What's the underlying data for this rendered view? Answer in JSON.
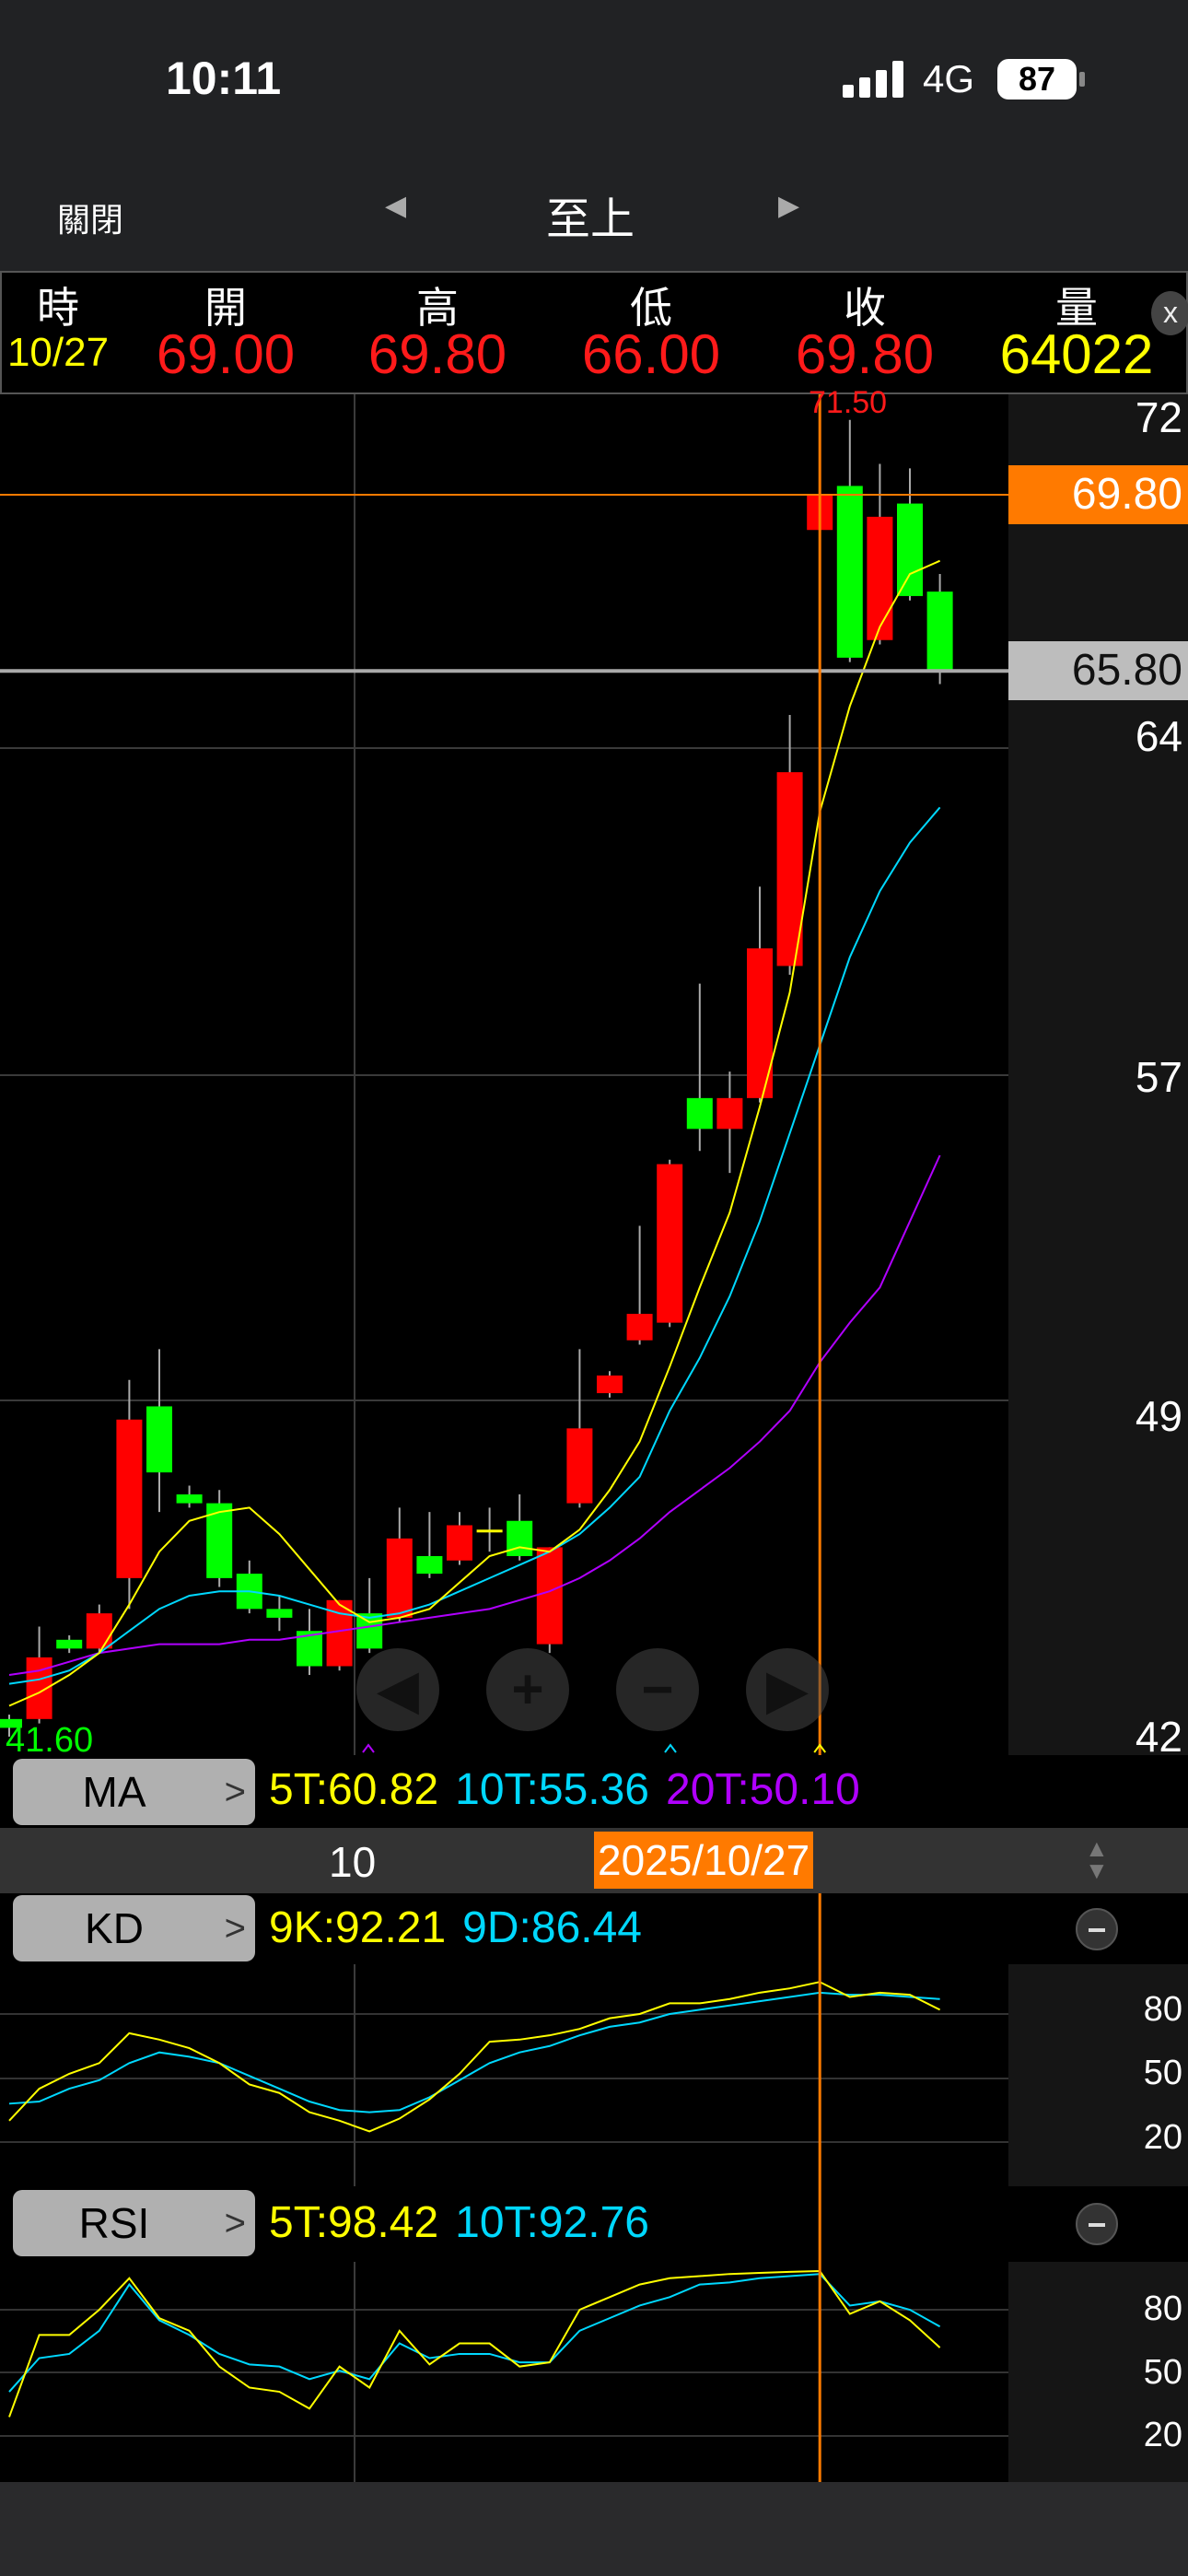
{
  "status": {
    "time": "10:11",
    "network": "4G",
    "battery": "87"
  },
  "nav": {
    "close": "關閉",
    "title": "至上",
    "prev": "◀",
    "next": "▶"
  },
  "header": {
    "labels": [
      "時",
      "開",
      "高",
      "低",
      "收",
      "量"
    ],
    "values": [
      "10/27",
      "69.00",
      "69.80",
      "66.00",
      "69.80",
      "64022"
    ],
    "close_icon": "x"
  },
  "chart_data": {
    "type": "candlestick",
    "y_ticks": [
      "72",
      "64",
      "57",
      "49",
      "42"
    ],
    "price_lines": {
      "last": "69.80",
      "ref": "65.80"
    },
    "max_label": "71.50",
    "min_label": "41.60",
    "candles": [
      [
        42.0,
        42.1,
        41.6,
        41.8
      ],
      [
        42.0,
        44.1,
        41.9,
        43.4
      ],
      [
        43.8,
        43.9,
        43.5,
        43.6
      ],
      [
        43.6,
        44.6,
        43.5,
        44.4
      ],
      [
        45.2,
        49.7,
        44.5,
        48.8
      ],
      [
        49.1,
        50.4,
        46.7,
        47.6
      ],
      [
        47.1,
        47.3,
        46.8,
        46.9
      ],
      [
        46.9,
        47.2,
        45.0,
        45.2
      ],
      [
        45.3,
        45.6,
        44.4,
        44.5
      ],
      [
        44.5,
        44.8,
        44.0,
        44.3
      ],
      [
        44.0,
        44.5,
        43.0,
        43.2
      ],
      [
        43.2,
        44.7,
        43.1,
        44.7
      ],
      [
        44.4,
        45.2,
        43.5,
        43.6
      ],
      [
        44.3,
        46.8,
        44.2,
        46.1
      ],
      [
        45.7,
        46.7,
        45.2,
        45.3
      ],
      [
        45.6,
        46.7,
        45.5,
        46.4
      ],
      [
        46.3,
        46.8,
        45.8,
        46.3
      ],
      [
        46.5,
        47.1,
        45.6,
        45.7
      ],
      [
        43.7,
        45.9,
        43.5,
        45.9
      ],
      [
        46.9,
        50.4,
        46.8,
        48.6
      ],
      [
        49.4,
        49.9,
        49.3,
        49.8
      ],
      [
        50.6,
        53.2,
        50.5,
        51.2
      ],
      [
        51.0,
        54.7,
        50.9,
        54.6
      ],
      [
        56.1,
        58.7,
        54.9,
        55.4
      ],
      [
        55.4,
        56.7,
        54.4,
        56.1
      ],
      [
        56.1,
        60.9,
        56.0,
        59.5
      ],
      [
        59.1,
        64.8,
        58.9,
        63.5
      ],
      [
        69.0,
        69.8,
        66.0,
        69.8
      ],
      [
        70.0,
        71.5,
        66.0,
        66.1
      ],
      [
        66.5,
        70.5,
        66.4,
        69.3
      ],
      [
        69.6,
        70.4,
        67.4,
        67.5
      ],
      [
        67.6,
        68.0,
        65.5,
        65.8
      ]
    ],
    "selected_index": 27,
    "ma5": [
      42.3,
      42.6,
      43.0,
      43.5,
      44.6,
      45.8,
      46.5,
      46.7,
      46.8,
      46.2,
      45.4,
      44.6,
      44.2,
      44.3,
      44.5,
      45.1,
      45.7,
      45.9,
      45.8,
      46.3,
      47.2,
      48.3,
      50.0,
      51.8,
      53.5,
      55.9,
      58.5,
      62.6,
      65.0,
      66.8,
      68.0,
      68.3
    ],
    "ma10": [
      42.8,
      42.9,
      43.1,
      43.5,
      44.0,
      44.5,
      44.8,
      44.9,
      44.9,
      44.8,
      44.6,
      44.4,
      44.3,
      44.4,
      44.6,
      44.9,
      45.2,
      45.5,
      45.8,
      46.2,
      46.8,
      47.5,
      49.0,
      50.2,
      51.6,
      53.3,
      55.3,
      57.3,
      59.3,
      60.8,
      61.9,
      62.7
    ],
    "ma20": [
      43.0,
      43.1,
      43.3,
      43.5,
      43.6,
      43.7,
      43.7,
      43.7,
      43.8,
      43.8,
      43.9,
      44.0,
      44.1,
      44.2,
      44.3,
      44.4,
      44.5,
      44.7,
      44.9,
      45.2,
      45.6,
      46.1,
      46.7,
      47.2,
      47.7,
      48.3,
      49.0,
      50.1,
      51.0,
      51.8,
      53.3,
      54.8
    ],
    "kd": {
      "k": [
        30,
        45,
        52,
        57,
        71,
        68,
        64,
        57,
        47,
        43,
        34,
        30,
        25,
        31,
        40,
        52,
        67,
        68,
        70,
        73,
        78,
        80,
        85,
        85,
        87,
        90,
        92,
        95,
        88,
        90,
        89,
        82
      ],
      "d": [
        38,
        39,
        45,
        49,
        57,
        62,
        60,
        57,
        51,
        45,
        39,
        35,
        34,
        35,
        41,
        49,
        57,
        62,
        65,
        70,
        74,
        76,
        80,
        82,
        84,
        86,
        88,
        90,
        89,
        89,
        88,
        87
      ],
      "ticks": [
        "80",
        "50",
        "20"
      ]
    },
    "rsi": {
      "r5": [
        29,
        68,
        68,
        80,
        95,
        76,
        70,
        53,
        43,
        41,
        33,
        53,
        43,
        70,
        54,
        64,
        64,
        53,
        55,
        80,
        86,
        92,
        95,
        96,
        97,
        97.5,
        98,
        98.4,
        78,
        84,
        75,
        62
      ],
      "r10": [
        41,
        57,
        59,
        70,
        92,
        75,
        68,
        59,
        54,
        53,
        47,
        51,
        47,
        64,
        57,
        59,
        59,
        55,
        55,
        70,
        76,
        82,
        86,
        92,
        93,
        95,
        96,
        97,
        82,
        84,
        80,
        72
      ],
      "ticks": [
        "80",
        "50",
        "20"
      ]
    }
  },
  "ma": {
    "label": "MA",
    "v5": "5T:60.82",
    "v10": "10T:55.36",
    "v20": "20T:50.10"
  },
  "datebar": {
    "tick": "10",
    "selected": "2025/10/27"
  },
  "kdrow": {
    "label": "KD",
    "k": "9K:92.21",
    "d": "9D:86.44"
  },
  "rsirow": {
    "label": "RSI",
    "r5": "5T:98.42",
    "r10": "10T:92.76"
  },
  "colors": {
    "up": "#ff0000",
    "down": "#00ff00",
    "ma5": "#ffff00",
    "ma10": "#00d8ff",
    "ma20": "#b000ff",
    "cursor": "#ff7a00"
  }
}
